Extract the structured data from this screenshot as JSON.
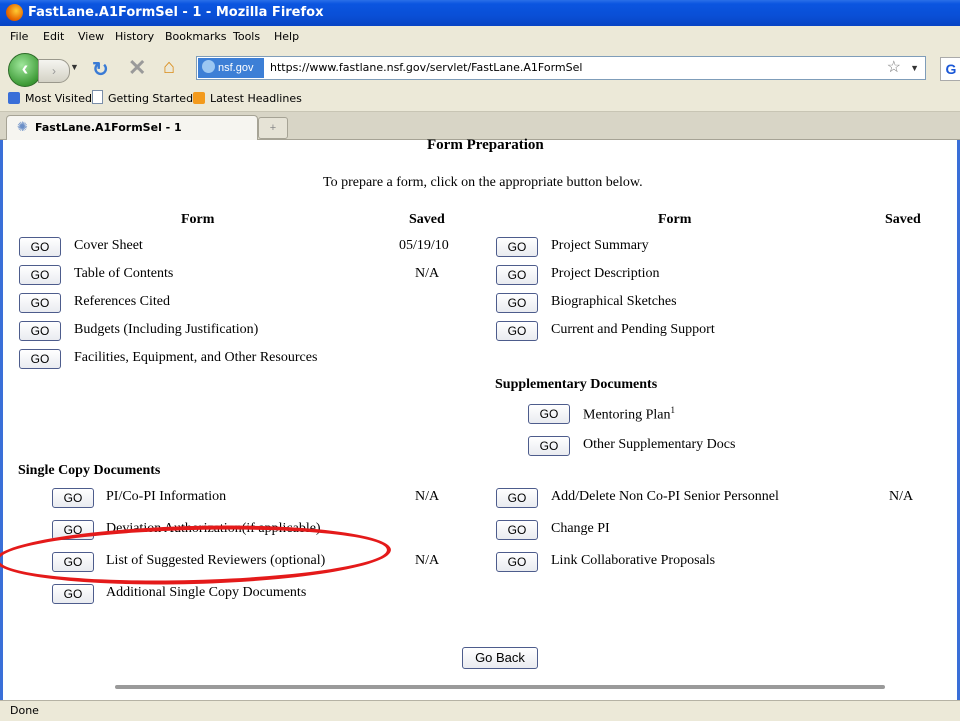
{
  "window": {
    "title": "FastLane.A1FormSel - 1 - Mozilla Firefox"
  },
  "menu": [
    "File",
    "Edit",
    "View",
    "History",
    "Bookmarks",
    "Tools",
    "Help"
  ],
  "nav": {
    "site_badge": "nsf.gov",
    "url": "https://www.fastlane.nsf.gov/servlet/FastLane.A1FormSel"
  },
  "bookmarks": [
    "Most Visited",
    "Getting Started",
    "Latest Headlines"
  ],
  "tab": {
    "label": "FastLane.A1FormSel - 1",
    "new_tab": "+"
  },
  "page": {
    "title": "Form Preparation",
    "instruction": "To prepare a form, click on the appropriate button below.",
    "col_form": "Form",
    "col_saved": "Saved",
    "go_label": "GO",
    "left_forms": [
      {
        "name": "Cover Sheet",
        "saved": "05/19/10"
      },
      {
        "name": "Table of Contents",
        "saved": "N/A"
      },
      {
        "name": "References Cited",
        "saved": ""
      },
      {
        "name": "Budgets (Including Justification)",
        "saved": ""
      },
      {
        "name": "Facilities, Equipment, and Other Resources",
        "saved": ""
      }
    ],
    "right_forms": [
      {
        "name": "Project Summary",
        "saved": ""
      },
      {
        "name": "Project Description",
        "saved": ""
      },
      {
        "name": "Biographical Sketches",
        "saved": ""
      },
      {
        "name": "Current and Pending Support",
        "saved": ""
      }
    ],
    "supplementary": {
      "heading": "Supplementary Documents",
      "items": [
        {
          "name": "Mentoring Plan",
          "sup": "1"
        },
        {
          "name": "Other Supplementary Docs",
          "sup": ""
        }
      ]
    },
    "single_copy": {
      "heading": "Single Copy Documents",
      "left": [
        {
          "name": "PI/Co-PI Information",
          "saved": "N/A"
        },
        {
          "name": "Deviation Authorization(if applicable)",
          "saved": ""
        },
        {
          "name": "List of Suggested Reviewers (optional)",
          "saved": "N/A"
        },
        {
          "name": "Additional Single Copy Documents",
          "saved": ""
        }
      ],
      "right": [
        {
          "name": "Add/Delete Non Co-PI Senior Personnel",
          "saved": "N/A"
        },
        {
          "name": "Change PI",
          "saved": ""
        },
        {
          "name": "Link Collaborative Proposals",
          "saved": ""
        }
      ]
    },
    "go_back": "Go Back",
    "highlight_color": "#e41a1a"
  },
  "status": "Done"
}
